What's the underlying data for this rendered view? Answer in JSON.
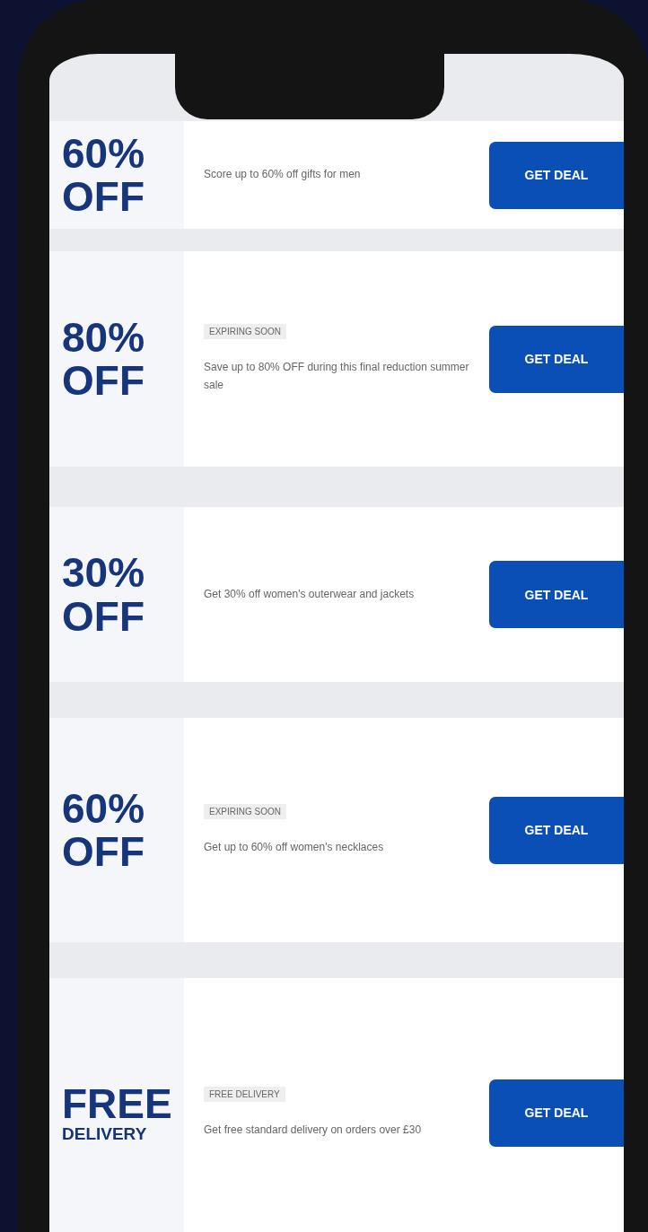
{
  "deals": [
    {
      "kind": "percent",
      "amount": "60%",
      "unit": "OFF",
      "description": "Score up to 60% off gifts for men",
      "button": "GET DEAL"
    },
    {
      "kind": "percent",
      "amount": "80%",
      "unit": "OFF",
      "tag": "EXPIRING SOON",
      "description": "Save up to 80% OFF during this final reduction summer sale",
      "button": "GET DEAL"
    },
    {
      "kind": "percent",
      "amount": "30%",
      "unit": "OFF",
      "description": "Get 30% off women's outerwear and jackets",
      "button": "GET DEAL"
    },
    {
      "kind": "percent",
      "amount": "60%",
      "unit": "OFF",
      "tag": "EXPIRING SOON",
      "description": "Get up to 60% off women's necklaces",
      "button": "GET DEAL"
    },
    {
      "kind": "word",
      "amount": "FREE",
      "unit": "DELIVERY",
      "tag": "FREE DELIVERY",
      "description": "Get free standard delivery on orders over £30",
      "button": "GET DEAL"
    }
  ]
}
